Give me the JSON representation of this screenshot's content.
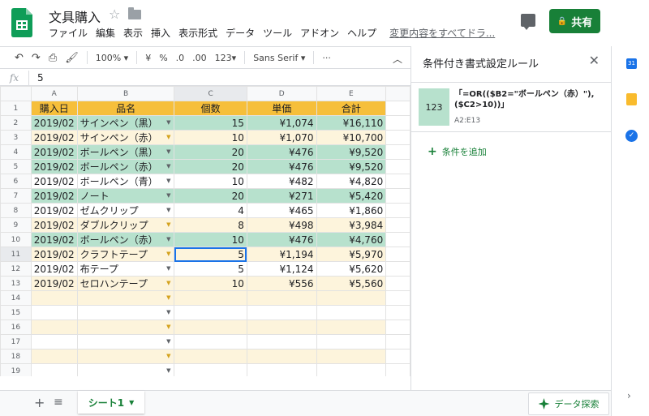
{
  "header": {
    "title": "文具購入",
    "menu": [
      "ファイル",
      "編集",
      "表示",
      "挿入",
      "表示形式",
      "データ",
      "ツール",
      "アドオン",
      "ヘルプ"
    ],
    "last_edit": "変更内容をすべてドラ...",
    "share_label": "共有",
    "colors": {
      "share": "#188038"
    }
  },
  "toolbar": {
    "zoom": "100%",
    "currency": "¥",
    "percent": "%",
    "dec_less": ".0",
    "dec_more": ".00",
    "format_more": "123",
    "font": "Sans Serif",
    "more": "···"
  },
  "formula_bar": {
    "fx": "fx",
    "value": "5"
  },
  "grid": {
    "columns": [
      "A",
      "B",
      "C",
      "D",
      "E"
    ],
    "header_row": [
      "購入日",
      "品名",
      "個数",
      "単価",
      "合計"
    ],
    "rows": [
      {
        "n": "2",
        "date": "2019/02",
        "item": "サインペン（黒）",
        "qty": "15",
        "price": "¥1,074",
        "total": "¥16,110",
        "style": "green"
      },
      {
        "n": "3",
        "date": "2019/02",
        "item": "サインペン（赤）",
        "qty": "10",
        "price": "¥1,070",
        "total": "¥10,700",
        "style": "cream"
      },
      {
        "n": "4",
        "date": "2019/02",
        "item": "ボールペン（黒）",
        "qty": "20",
        "price": "¥476",
        "total": "¥9,520",
        "style": "green"
      },
      {
        "n": "5",
        "date": "2019/02",
        "item": "ボールペン（赤）",
        "qty": "20",
        "price": "¥476",
        "total": "¥9,520",
        "style": "green"
      },
      {
        "n": "6",
        "date": "2019/02",
        "item": "ボールペン（青）",
        "qty": "10",
        "price": "¥482",
        "total": "¥4,820",
        "style": "plain"
      },
      {
        "n": "7",
        "date": "2019/02",
        "item": "ノート",
        "qty": "20",
        "price": "¥271",
        "total": "¥5,420",
        "style": "green"
      },
      {
        "n": "8",
        "date": "2019/02",
        "item": "ゼムクリップ",
        "qty": "4",
        "price": "¥465",
        "total": "¥1,860",
        "style": "plain"
      },
      {
        "n": "9",
        "date": "2019/02",
        "item": "ダブルクリップ",
        "qty": "8",
        "price": "¥498",
        "total": "¥3,984",
        "style": "cream"
      },
      {
        "n": "10",
        "date": "2019/02",
        "item": "ボールペン（赤）",
        "qty": "10",
        "price": "¥476",
        "total": "¥4,760",
        "style": "green"
      },
      {
        "n": "11",
        "date": "2019/02",
        "item": "クラフトテープ",
        "qty": "5",
        "price": "¥1,194",
        "total": "¥5,970",
        "style": "cream"
      },
      {
        "n": "12",
        "date": "2019/02",
        "item": "布テープ",
        "qty": "5",
        "price": "¥1,124",
        "total": "¥5,620",
        "style": "plain"
      },
      {
        "n": "13",
        "date": "2019/02",
        "item": "セロハンテープ",
        "qty": "10",
        "price": "¥556",
        "total": "¥5,560",
        "style": "cream"
      }
    ],
    "empty_rows": [
      "14",
      "15",
      "16",
      "17",
      "18",
      "19"
    ],
    "colors": {
      "header": "#f6bf3b",
      "green": "#b7e1cd",
      "cream": "#fdf4dc"
    }
  },
  "panel": {
    "title": "条件付き書式設定ルール",
    "rule_preview": "123",
    "rule_formula": "「=OR(($B2=\"ボールペン（赤）\"),($C2>10))」",
    "rule_range": "A2:E13",
    "add_rule": "条件を追加"
  },
  "side": {
    "calendar_label": "31"
  },
  "bottom": {
    "sheet_tab": "シート1",
    "explore": "データ探索"
  }
}
